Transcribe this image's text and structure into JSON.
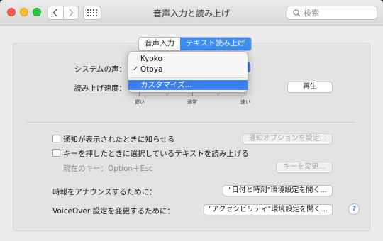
{
  "window": {
    "title": "音声入力と読み上げ",
    "search_placeholder": "検索"
  },
  "tabs": [
    {
      "label": "音声入力",
      "active": false
    },
    {
      "label": "テキスト読み上げ",
      "active": true
    }
  ],
  "voice": {
    "label": "システムの声：",
    "menu_items": [
      {
        "label": "Kyoko",
        "checked": false
      },
      {
        "label": "Otoya",
        "checked": true
      }
    ],
    "customize_label": "カスタマイズ..."
  },
  "rate": {
    "label": "読み上げ速度：",
    "slow": "遅い",
    "normal": "通常",
    "fast": "速い",
    "play_button": "再生"
  },
  "options": {
    "announce_alerts": "通知が表示されたときに知らせる",
    "alert_options_button": "通知オプションを設定...",
    "speak_selection": "キーを押したときに選択しているテキストを読み上げる",
    "current_key": "現在のキー：Option＋Esc",
    "change_key_button": "キーを変更..."
  },
  "clock": {
    "label": "時報をアナウンスするために：",
    "button": "\"日付と時刻\"環境設定を開く..."
  },
  "voiceover": {
    "label": "VoiceOver 設定を変更するために：",
    "button": "\"アクセシビリティ\"環境設定を開く..."
  },
  "colors": {
    "accent": "#3b80f3",
    "close": "#fc5d57",
    "minimize": "#fdbc2e",
    "zoom": "#28c840"
  }
}
